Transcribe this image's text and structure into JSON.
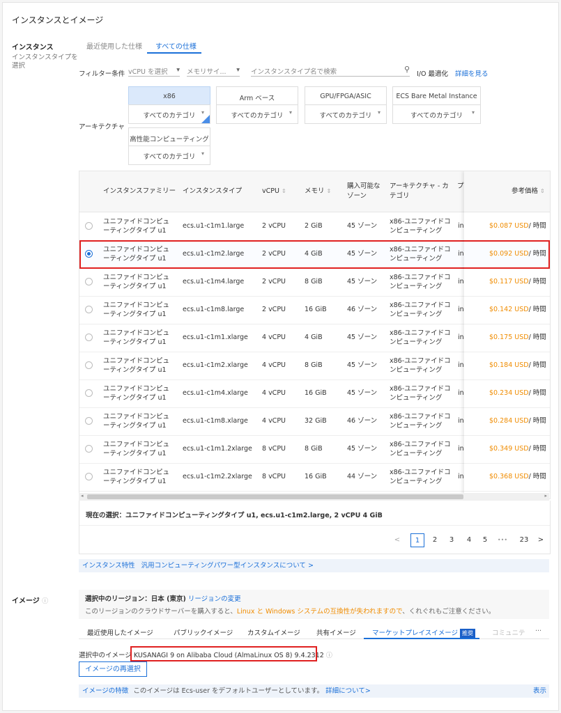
{
  "page_title": "インスタンスとイメージ",
  "instance": {
    "label": "インスタンス",
    "sublabel_1": "インスタンスタイプを",
    "sublabel_2": "選択",
    "tabs": [
      "最近使用した仕様",
      "すべての仕様"
    ],
    "active_tab": "すべての仕様"
  },
  "filter": {
    "label": "フィルター条件",
    "vcpu_placeholder": "vCPU を選択",
    "memory_placeholder": "メモリサイ...",
    "search_placeholder": "インスタンスタイプ名で検索",
    "io_label": "I/O 最適化",
    "details_link": "詳細を見る"
  },
  "architecture": {
    "label": "アーキテクチャ",
    "options": [
      {
        "name": "x86",
        "category": "すべてのカテゴリ",
        "selected": true
      },
      {
        "name": "Arm ベース",
        "category": "すべてのカテゴリ",
        "selected": false
      },
      {
        "name": "GPU/FPGA/ASIC",
        "category": "すべてのカテゴリ",
        "selected": false
      },
      {
        "name": "ECS Bare Metal Instance",
        "category": "すべてのカテゴリ",
        "selected": false
      },
      {
        "name": "高性能コンピューティング",
        "category": "すべてのカテゴリ",
        "selected": false
      }
    ]
  },
  "table": {
    "headers": {
      "family": "インスタンスファミリー",
      "type": "インスタンスタイプ",
      "vcpu": "vCPU",
      "memory": "メモリ",
      "zones_1": "購入可能な",
      "zones_2": "ゾーン",
      "arch_1": "アーキテクチャ - カ",
      "arch_2": "テゴリ",
      "cut": "プ",
      "price": "参考価格"
    },
    "rows": [
      {
        "family_1": "ユニファイドコンピュ",
        "family_2": "ーティングタイプ u1",
        "type": "ecs.u1-c1m1.large",
        "vcpu": "2 vCPU",
        "memory": "2 GiB",
        "zones": "45 ゾーン",
        "arch_1": "x86-ユニファイドコ",
        "arch_2": "ンピューティング",
        "cut": "in",
        "price": "$0.087 USD",
        "unit": "/ 時間",
        "selected": false
      },
      {
        "family_1": "ユニファイドコンピュ",
        "family_2": "ーティングタイプ u1",
        "type": "ecs.u1-c1m2.large",
        "vcpu": "2 vCPU",
        "memory": "4 GiB",
        "zones": "45 ゾーン",
        "arch_1": "x86-ユニファイドコ",
        "arch_2": "ンピューティング",
        "cut": "in",
        "price": "$0.092 USD",
        "unit": "/ 時間",
        "selected": true
      },
      {
        "family_1": "ユニファイドコンピュ",
        "family_2": "ーティングタイプ u1",
        "type": "ecs.u1-c1m4.large",
        "vcpu": "2 vCPU",
        "memory": "8 GiB",
        "zones": "45 ゾーン",
        "arch_1": "x86-ユニファイドコ",
        "arch_2": "ンピューティング",
        "cut": "in",
        "price": "$0.117 USD",
        "unit": "/ 時間",
        "selected": false
      },
      {
        "family_1": "ユニファイドコンピュ",
        "family_2": "ーティングタイプ u1",
        "type": "ecs.u1-c1m8.large",
        "vcpu": "2 vCPU",
        "memory": "16 GiB",
        "zones": "46 ゾーン",
        "arch_1": "x86-ユニファイドコ",
        "arch_2": "ンピューティング",
        "cut": "in",
        "price": "$0.142 USD",
        "unit": "/ 時間",
        "selected": false
      },
      {
        "family_1": "ユニファイドコンピュ",
        "family_2": "ーティングタイプ u1",
        "type": "ecs.u1-c1m1.xlarge",
        "vcpu": "4 vCPU",
        "memory": "4 GiB",
        "zones": "45 ゾーン",
        "arch_1": "x86-ユニファイドコ",
        "arch_2": "ンピューティング",
        "cut": "in",
        "price": "$0.175 USD",
        "unit": "/ 時間",
        "selected": false
      },
      {
        "family_1": "ユニファイドコンピュ",
        "family_2": "ーティングタイプ u1",
        "type": "ecs.u1-c1m2.xlarge",
        "vcpu": "4 vCPU",
        "memory": "8 GiB",
        "zones": "45 ゾーン",
        "arch_1": "x86-ユニファイドコ",
        "arch_2": "ンピューティング",
        "cut": "in",
        "price": "$0.184 USD",
        "unit": "/ 時間",
        "selected": false
      },
      {
        "family_1": "ユニファイドコンピュ",
        "family_2": "ーティングタイプ u1",
        "type": "ecs.u1-c1m4.xlarge",
        "vcpu": "4 vCPU",
        "memory": "16 GiB",
        "zones": "45 ゾーン",
        "arch_1": "x86-ユニファイドコ",
        "arch_2": "ンピューティング",
        "cut": "in",
        "price": "$0.234 USD",
        "unit": "/ 時間",
        "selected": false
      },
      {
        "family_1": "ユニファイドコンピュ",
        "family_2": "ーティングタイプ u1",
        "type": "ecs.u1-c1m8.xlarge",
        "vcpu": "4 vCPU",
        "memory": "32 GiB",
        "zones": "46 ゾーン",
        "arch_1": "x86-ユニファイドコ",
        "arch_2": "ンピューティング",
        "cut": "in",
        "price": "$0.284 USD",
        "unit": "/ 時間",
        "selected": false
      },
      {
        "family_1": "ユニファイドコンピュ",
        "family_2": "ーティングタイプ u1",
        "type": "ecs.u1-c1m1.2xlarge",
        "vcpu": "8 vCPU",
        "memory": "8 GiB",
        "zones": "45 ゾーン",
        "arch_1": "x86-ユニファイドコ",
        "arch_2": "ンピューティング",
        "cut": "in",
        "price": "$0.349 USD",
        "unit": "/ 時間",
        "selected": false
      },
      {
        "family_1": "ユニファイドコンピュ",
        "family_2": "ーティングタイプ u1",
        "type": "ecs.u1-c1m2.2xlarge",
        "vcpu": "8 vCPU",
        "memory": "16 GiB",
        "zones": "44 ゾーン",
        "arch_1": "x86-ユニファイドコ",
        "arch_2": "ンピューティング",
        "cut": "in",
        "price": "$0.368 USD",
        "unit": "/ 時間",
        "selected": false
      }
    ]
  },
  "current_selection": "現在の選択：ユニファイドコンピューティングタイプ u1, ecs.u1-c1m2.large, 2 vCPU 4 GiB",
  "pagination": {
    "prev": "<",
    "pages": [
      "1",
      "2",
      "3",
      "4",
      "5"
    ],
    "ellipsis": "•••",
    "last": "23",
    "next": ">",
    "current": "1"
  },
  "instance_feature": {
    "label": "インスタンス特性",
    "link": "汎用コンピューティングパワー型インスタンスについて >"
  },
  "image": {
    "label": "イメージ",
    "region_label": "選択中のリージョン：日本 (東京)",
    "region_change": "リージョンの変更",
    "notice_pre": "このリージョンのクラウドサーバーを購入すると、",
    "notice_warn": "Linux と Windows システムの互換性が失われますので",
    "notice_post": "、くれぐれもご注意ください。",
    "tabs": [
      "最近使用したイメージ",
      "パブリックイメージ",
      "カスタムイメージ",
      "共有イメージ",
      "マーケットプレイスイメージ",
      "コミュニテ"
    ],
    "active_tab": "マーケットプレイスイメージ",
    "badge": "推奨",
    "more": "···",
    "selected_label": "選択中のイメージ",
    "selected_value": "KUSANAGI 9 on Alibaba Cloud (AlmaLinux OS 8) 9.4.2312",
    "reselect_button": "イメージの再選択",
    "feature_label": "イメージの特徴",
    "feature_text": "このイメージは Ecs-user をデフォルトユーザーとしています。",
    "feature_link": "詳細について>",
    "show": "表示"
  },
  "colors": {
    "accent": "#1a6fd8",
    "price": "#f08c00",
    "highlight": "#e02020"
  }
}
